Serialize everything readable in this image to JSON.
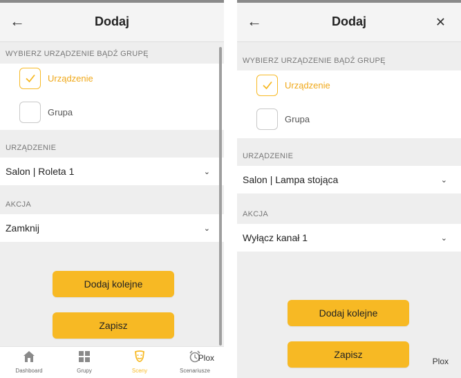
{
  "left": {
    "title": "Dodaj",
    "section_choose": "WYBIERZ URZĄDZENIE BĄDŹ GRUPĘ",
    "option_device": "Urządzenie",
    "option_group": "Grupa",
    "section_device": "URZĄDZENIE",
    "device_value": "Salon | Roleta 1",
    "section_action": "AKCJA",
    "action_value": "Zamknij",
    "btn_add_more": "Dodaj kolejne",
    "btn_save": "Zapisz",
    "nav": [
      "Dashboard",
      "Grupy",
      "Sceny",
      "Scenariusze"
    ],
    "brand": "Plox"
  },
  "right": {
    "title": "Dodaj",
    "section_choose": "WYBIERZ URZĄDZENIE BĄDŹ GRUPĘ",
    "option_device": "Urządzenie",
    "option_group": "Grupa",
    "section_device": "URZĄDZENIE",
    "device_value": "Salon | Lampa stojąca",
    "section_action": "AKCJA",
    "action_value": "Wyłącz kanał 1",
    "btn_add_more": "Dodaj kolejne",
    "btn_save": "Zapisz",
    "brand": "Plox"
  },
  "icons": {
    "back": "arrow-left-icon",
    "close": "close-icon",
    "check": "check-icon",
    "dropdown": "chevron-down-icon"
  },
  "colors": {
    "accent": "#f7b924",
    "background": "#eeeeee",
    "panel": "#ffffff"
  }
}
